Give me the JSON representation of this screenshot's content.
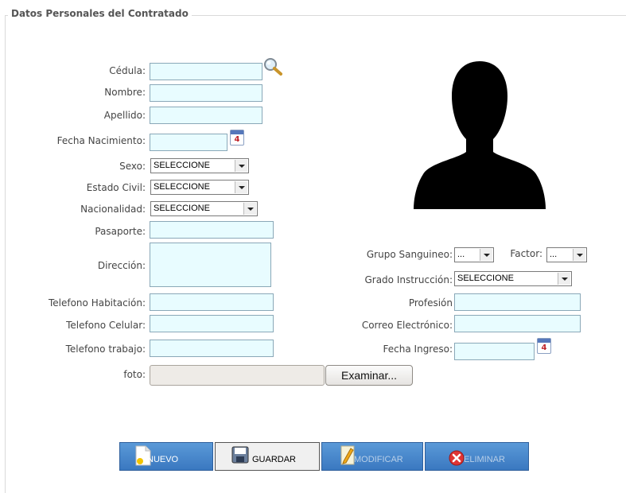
{
  "section": {
    "title": "Datos Personales del Contratado"
  },
  "fields": {
    "cedula": {
      "label": "Cédula:",
      "value": ""
    },
    "nombre": {
      "label": "Nombre:",
      "value": ""
    },
    "apellido": {
      "label": "Apellido:",
      "value": ""
    },
    "fecha_nacimiento": {
      "label": "Fecha Nacimiento:",
      "value": ""
    },
    "sexo": {
      "label": "Sexo:",
      "selected": "SELECCIONE"
    },
    "estado_civil": {
      "label": "Estado Civil:",
      "selected": "SELECCIONE"
    },
    "nacionalidad": {
      "label": "Nacionalidad:",
      "selected": "SELECCIONE"
    },
    "pasaporte": {
      "label": "Pasaporte:",
      "value": ""
    },
    "direccion": {
      "label": "Dirección:",
      "value": ""
    },
    "grupo_sanguineo": {
      "label": "Grupo Sanguineo:",
      "selected": "..."
    },
    "factor": {
      "label": "Factor:",
      "selected": "..."
    },
    "grado_instruccion": {
      "label": "Grado Instrucción:",
      "selected": "SELECCIONE"
    },
    "telefono_habitacion": {
      "label": "Telefono Habitación:",
      "value": ""
    },
    "profesion": {
      "label": "Profesión",
      "value": ""
    },
    "telefono_celular": {
      "label": "Telefono Celular:",
      "value": ""
    },
    "correo": {
      "label": "Correo Electrónico:",
      "value": ""
    },
    "telefono_trabajo": {
      "label": "Telefono trabajo:",
      "value": ""
    },
    "fecha_ingreso": {
      "label": "Fecha Ingreso:",
      "value": ""
    },
    "foto": {
      "label": "foto:",
      "button": "Examinar..."
    }
  },
  "calendar_icon_day": "4",
  "toolbar": {
    "nuevo": "NUEVO",
    "guardar": "GUARDAR",
    "modificar": "MODIFICAR",
    "eliminar": "ELIMINAR"
  },
  "icons": {
    "search": "magnifier-icon",
    "calendar": "calendar-icon",
    "photo": "person-silhouette-icon"
  }
}
